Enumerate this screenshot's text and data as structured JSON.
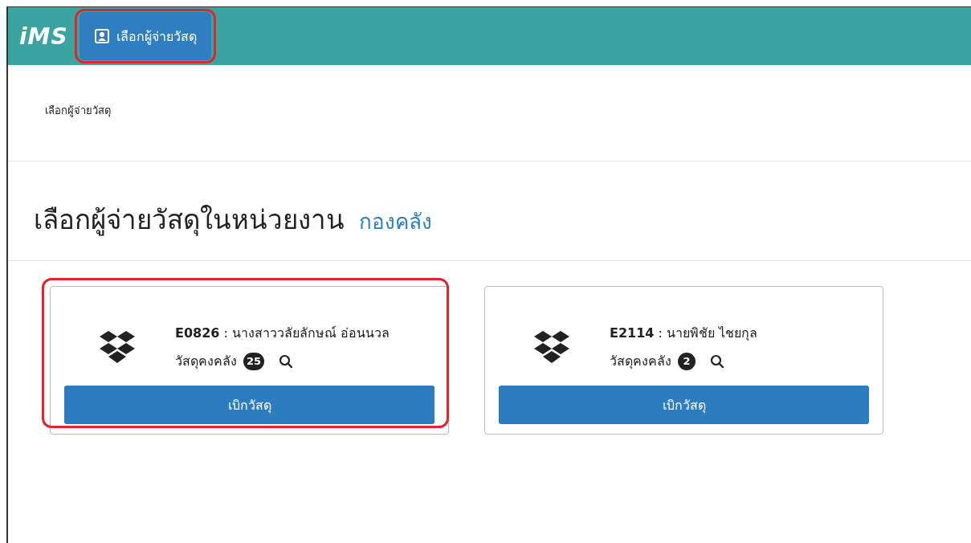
{
  "header": {
    "logo": "iMS",
    "nav_items": [
      {
        "label": "เลือกผู้จ่ายวัสดุ",
        "selected": true,
        "highlighted": true
      }
    ]
  },
  "breadcrumb": "เลือกผู้จ่ายวัสดุ",
  "page_title": {
    "text": "เลือกผู้จ่ายวัสดุในหน่วยงาน",
    "department": "กองคลัง"
  },
  "cards": [
    {
      "title": "**E0826** : นางสาววลัยลักษณ์ อ่อนนวล",
      "stock_label": "วัสดุคงคลัง",
      "count": "25",
      "button": "เบิกวัสดุ",
      "highlighted": true
    },
    {
      "title": "**E2114** : นายพิชัย ไชยกุล",
      "stock_label": "วัสดุคงคลัง",
      "count": "2",
      "button": "เบิกวัสดุ",
      "highlighted": false
    }
  ]
}
